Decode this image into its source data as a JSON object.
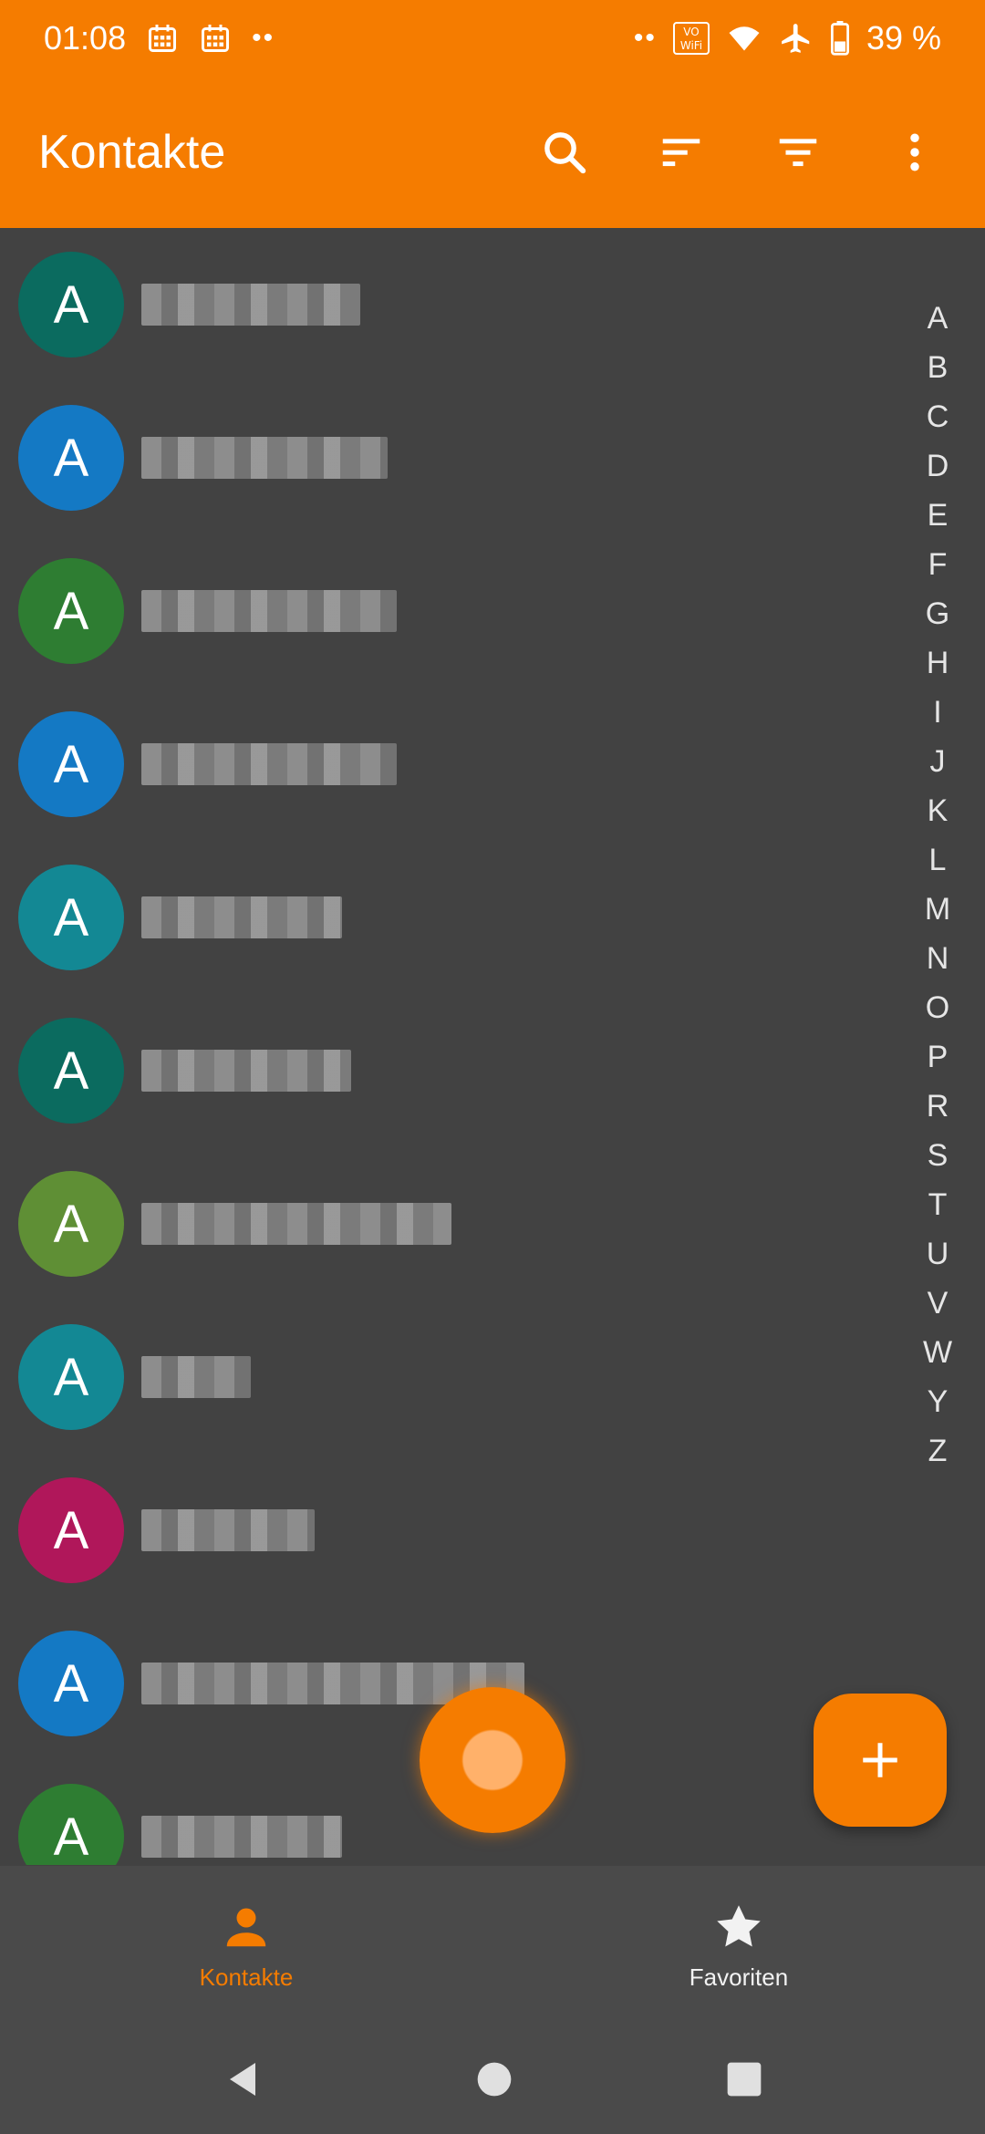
{
  "status_bar": {
    "time": "01:08",
    "battery": "39 %",
    "vowifi": "VO\nWiFi",
    "icons": [
      "calendar-icon",
      "calendar-icon",
      "notification-dots-icon",
      "notification-dots-icon",
      "vowifi-icon",
      "wifi-icon",
      "airplane-icon",
      "battery-icon"
    ]
  },
  "app_bar": {
    "title": "Kontakte",
    "actions": [
      "search-icon",
      "sort-icon",
      "filter-icon",
      "more-vert-icon"
    ]
  },
  "contacts": [
    {
      "initial": "A",
      "color": "#0b6b5f",
      "name": "",
      "name_width": 240
    },
    {
      "initial": "A",
      "color": "#1479c4",
      "name": "",
      "name_width": 270
    },
    {
      "initial": "A",
      "color": "#2e7d32",
      "name": "",
      "name_width": 280
    },
    {
      "initial": "A",
      "color": "#1479c4",
      "name": "",
      "name_width": 280
    },
    {
      "initial": "A",
      "color": "#138894",
      "name": "",
      "name_width": 220
    },
    {
      "initial": "A",
      "color": "#0b6b5f",
      "name": "",
      "name_width": 230
    },
    {
      "initial": "A",
      "color": "#5f8f35",
      "name": "",
      "name_width": 340
    },
    {
      "initial": "A",
      "color": "#138894",
      "name": "",
      "name_width": 120
    },
    {
      "initial": "A",
      "color": "#b0175a",
      "name": "",
      "name_width": 190
    },
    {
      "initial": "A",
      "color": "#1479c4",
      "name": "",
      "name_width": 420
    },
    {
      "initial": "A",
      "color": "#2e7d32",
      "name": "",
      "name_width": 220
    }
  ],
  "alphabet_index": [
    "A",
    "B",
    "C",
    "D",
    "E",
    "F",
    "G",
    "H",
    "I",
    "J",
    "K",
    "L",
    "M",
    "N",
    "O",
    "P",
    "R",
    "S",
    "T",
    "U",
    "V",
    "W",
    "Y",
    "Z"
  ],
  "fab": {
    "icon": "plus-icon"
  },
  "bottom_nav": {
    "items": [
      {
        "label": "Kontakte",
        "icon": "person-icon",
        "active": true
      },
      {
        "label": "Favoriten",
        "icon": "star-icon",
        "active": false
      }
    ]
  },
  "system_nav": [
    "back-icon",
    "home-icon",
    "recents-icon"
  ],
  "colors": {
    "accent": "#f57c00",
    "background": "#424242",
    "nav_background": "#4a4a4a"
  }
}
